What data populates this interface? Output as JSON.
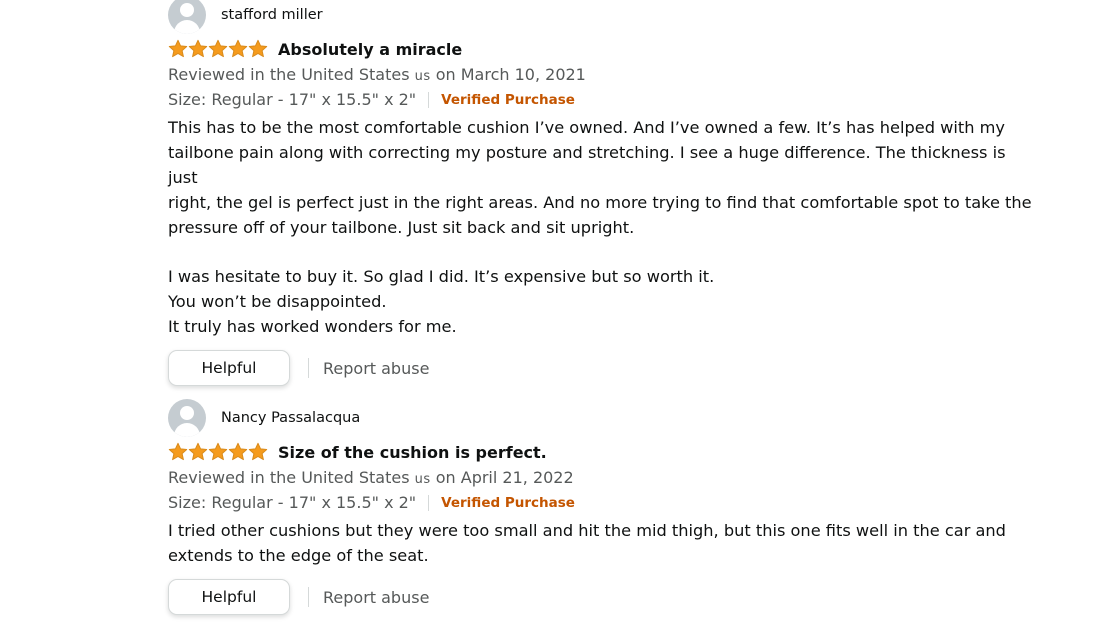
{
  "colors": {
    "star": "#f59b1d",
    "star_outline": "#d98b1c",
    "verified": "#c45500",
    "muted_text": "#565959",
    "text": "#0f1111",
    "avatar_bg": "#c5ccd1"
  },
  "reviews": [
    {
      "profile_name": "stafford miller",
      "avatar_icon": "user-avatar-icon",
      "rating": 5,
      "rating_max": 5,
      "title": "Absolutely a miracle",
      "reviewed_in_prefix": "Reviewed in the United States",
      "country_code": "us",
      "date_text": "on March 10, 2021",
      "size_text": "Size: Regular - 17\" x 15.5\" x 2\"",
      "verified_label": "Verified Purchase",
      "body": {
        "p1": "This has to be the most comfortable cushion I’ve owned. And I’ve owned a few. It’s has helped with my",
        "p2": "tailbone pain along with correcting my posture and stretching. I see a huge difference. The thickness is just",
        "p3": "right, the gel is perfect just in the right areas. And no more trying to find that comfortable spot to take the",
        "p4": "pressure off of your tailbone. Just sit back and sit upright.",
        "p5": "I was hesitate to buy it. So glad I did. It’s expensive but so worth it.",
        "p6": "You won’t be disappointed.",
        "p7": "It truly has worked wonders for me."
      },
      "helpful_label": "Helpful",
      "report_label": "Report abuse"
    },
    {
      "profile_name": "Nancy Passalacqua",
      "avatar_icon": "user-avatar-icon",
      "rating": 5,
      "rating_max": 5,
      "title": "Size of the cushion is perfect.",
      "reviewed_in_prefix": "Reviewed in the United States",
      "country_code": "us",
      "date_text": "on April 21, 2022",
      "size_text": "Size: Regular - 17\" x 15.5\" x 2\"",
      "verified_label": "Verified Purchase",
      "body": {
        "p1": "I tried other cushions but they were too small and hit the mid thigh, but this one fits well in the car and",
        "p2": "extends to the edge of the seat."
      },
      "helpful_label": "Helpful",
      "report_label": "Report abuse"
    }
  ]
}
